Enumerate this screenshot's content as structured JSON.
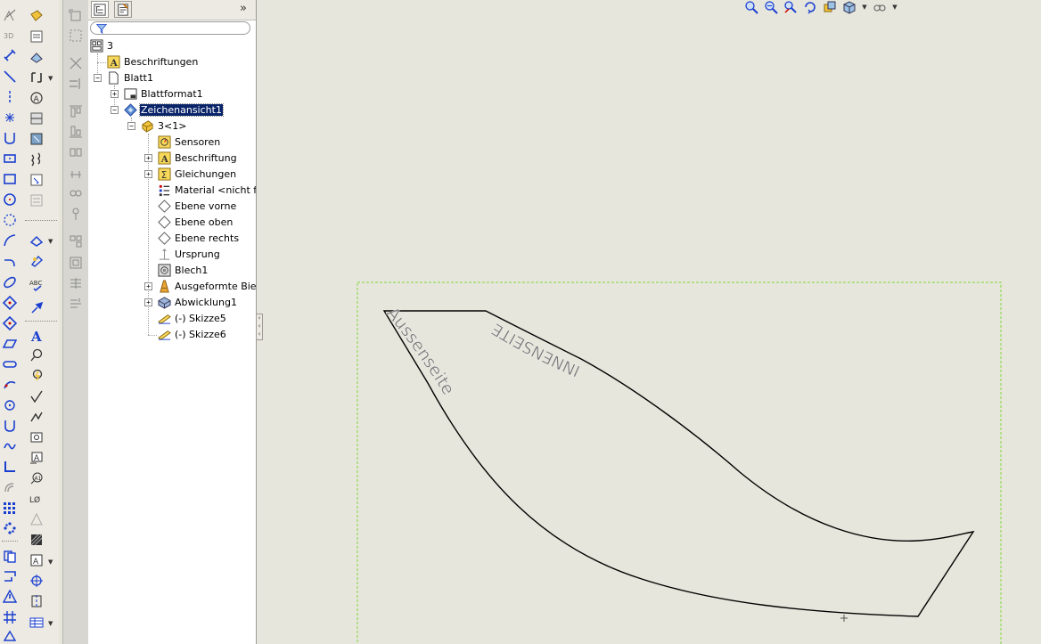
{
  "panel": {
    "tabs": [
      "feature-tree-tab",
      "property-tab"
    ],
    "collapse_glyph": "»",
    "filter_placeholder": ""
  },
  "tree": {
    "root": "3",
    "items": [
      {
        "label": "Beschriftungen",
        "icon": "annotation-icon"
      },
      {
        "label": "Blatt1",
        "icon": "sheet-icon"
      },
      {
        "label": "Blattformat1",
        "icon": "sheet-format-icon"
      },
      {
        "label": "Zeichenansicht1",
        "icon": "drawing-view-icon",
        "selected": true
      },
      {
        "label": "3<1>",
        "icon": "part-icon"
      },
      {
        "label": "Sensoren",
        "icon": "sensor-icon"
      },
      {
        "label": "Beschriftung",
        "icon": "annotation-icon"
      },
      {
        "label": "Gleichungen",
        "icon": "equations-icon"
      },
      {
        "label": "Material <nicht fes",
        "icon": "material-icon"
      },
      {
        "label": "Ebene vorne",
        "icon": "plane-icon"
      },
      {
        "label": "Ebene oben",
        "icon": "plane-icon"
      },
      {
        "label": "Ebene rechts",
        "icon": "plane-icon"
      },
      {
        "label": "Ursprung",
        "icon": "origin-icon"
      },
      {
        "label": "Blech1",
        "icon": "sheet-metal-icon"
      },
      {
        "label": "Ausgeformte Biegu",
        "icon": "lofted-bend-icon"
      },
      {
        "label": "Abwicklung1",
        "icon": "flat-pattern-icon"
      },
      {
        "label": "(-) Skizze5",
        "icon": "sketch-icon"
      },
      {
        "label": "(-) Skizze6",
        "icon": "sketch-icon"
      }
    ]
  },
  "drawing": {
    "label_outer": "Aussenseite",
    "label_inner": "INNENSEITE",
    "line_color": "#000000",
    "text_color": "#7a7a7a",
    "border_color": "#7fd83a"
  },
  "colors": {
    "background": "#e7e6dc",
    "selection": "#0a246a",
    "toolbar": "#eceae2"
  },
  "view_toolbar": [
    "zoom-fit-icon",
    "zoom-area-icon",
    "previous-view-icon",
    "rotate-icon",
    "pan-icon",
    "view-orientation-icon",
    "display-style-icon"
  ]
}
